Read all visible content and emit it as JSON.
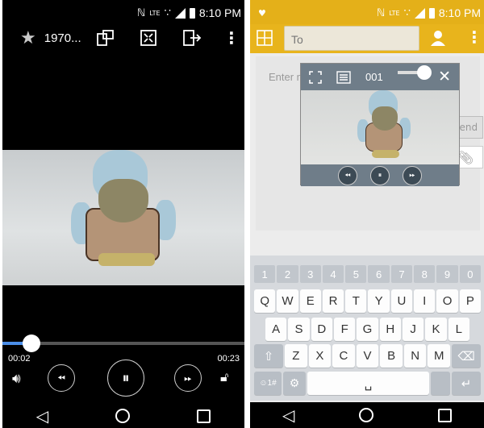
{
  "status_bar": {
    "network": "LTE",
    "time": "8:10 PM"
  },
  "player": {
    "title": "1970...",
    "current_time": "00:02",
    "total_time": "00:23",
    "progress": 0.12
  },
  "messaging": {
    "to_placeholder": "To",
    "enter_placeholder": "Enter m",
    "send_label": "Send",
    "mini_counter": "001"
  },
  "keyboard": {
    "number_row": [
      "1",
      "2",
      "3",
      "4",
      "5",
      "6",
      "7",
      "8",
      "9",
      "0"
    ],
    "row1": [
      "Q",
      "W",
      "E",
      "R",
      "T",
      "Y",
      "U",
      "I",
      "O",
      "P"
    ],
    "row2": [
      "A",
      "S",
      "D",
      "F",
      "G",
      "H",
      "J",
      "K",
      "L"
    ],
    "row3": [
      "Z",
      "X",
      "C",
      "V",
      "B",
      "N",
      "M"
    ],
    "symbol_key": "☺1#"
  },
  "colors": {
    "accent": "#e8b41c",
    "progress": "#4b8ee8"
  }
}
